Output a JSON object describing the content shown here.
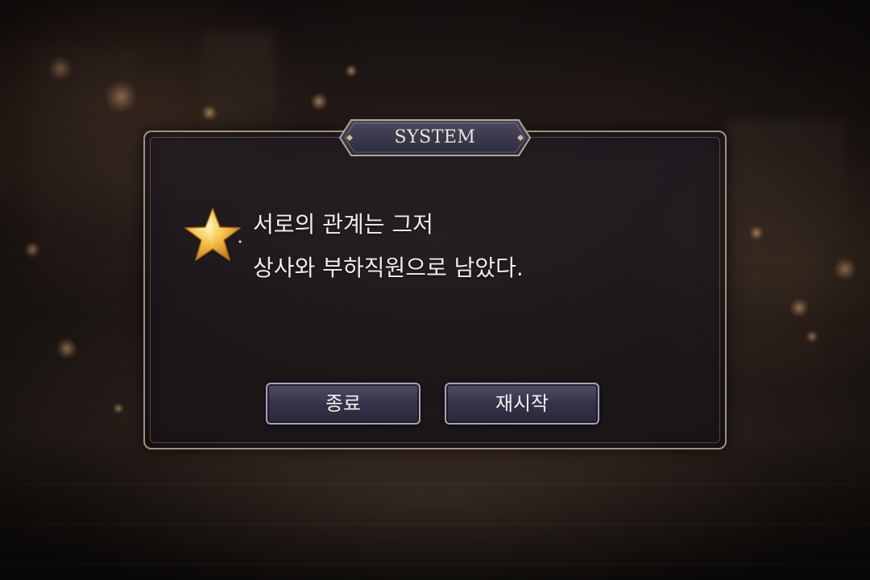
{
  "dialog": {
    "title": "SYSTEM",
    "icon": "star-icon",
    "message_line1": "서로의 관계는 그저",
    "message_line2": "상사와 부하직원으로 남았다."
  },
  "buttons": {
    "quit_label": "종료",
    "restart_label": "재시작"
  },
  "colors": {
    "frame": "#a58f7c",
    "button": "#3b3950",
    "star": "#f2b43a"
  }
}
